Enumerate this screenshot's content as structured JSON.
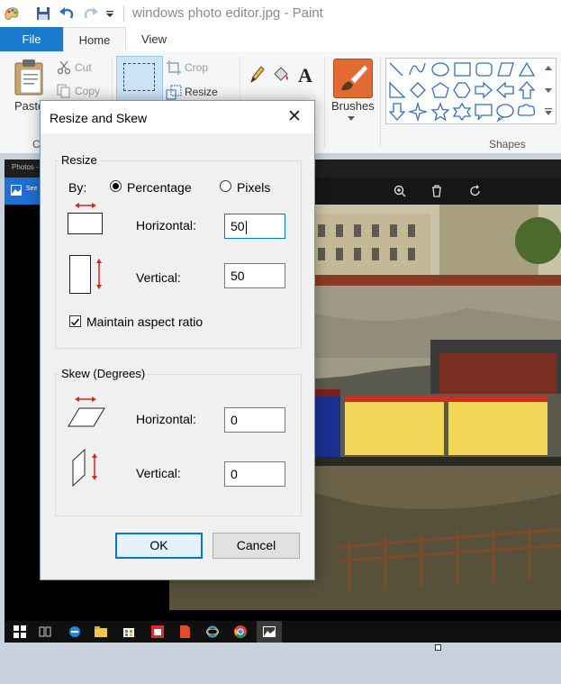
{
  "window": {
    "title": "windows photo editor.jpg - Paint"
  },
  "tabs": {
    "file": "File",
    "home": "Home",
    "view": "View"
  },
  "ribbon": {
    "paste": "Paste",
    "clipboard_group": "Cl",
    "cut": "Cut",
    "copy": "Copy",
    "crop": "Crop",
    "resize": "Resize",
    "brushes": "Brushes",
    "shapes_group": "Shapes"
  },
  "photos_app": {
    "title": "Photos -",
    "see_all": "See"
  },
  "dialog": {
    "title": "Resize and Skew",
    "resize_group": "Resize",
    "by_label": "By:",
    "percentage_label": "Percentage",
    "pixels_label": "Pixels",
    "selected_mode": "Percentage",
    "horizontal_label": "Horizontal:",
    "horizontal_value": "50",
    "vertical_label": "Vertical:",
    "vertical_value": "50",
    "maintain_label": "Maintain aspect ratio",
    "maintain_checked": true,
    "skew_group": "Skew (Degrees)",
    "skew_horizontal_label": "Horizontal:",
    "skew_horizontal_value": "0",
    "skew_vertical_label": "Vertical:",
    "skew_vertical_value": "0",
    "ok": "OK",
    "cancel": "Cancel"
  },
  "colors": {
    "accent": "#0078d7",
    "file_tab": "#1979ca",
    "arrow": "#d9261c"
  }
}
